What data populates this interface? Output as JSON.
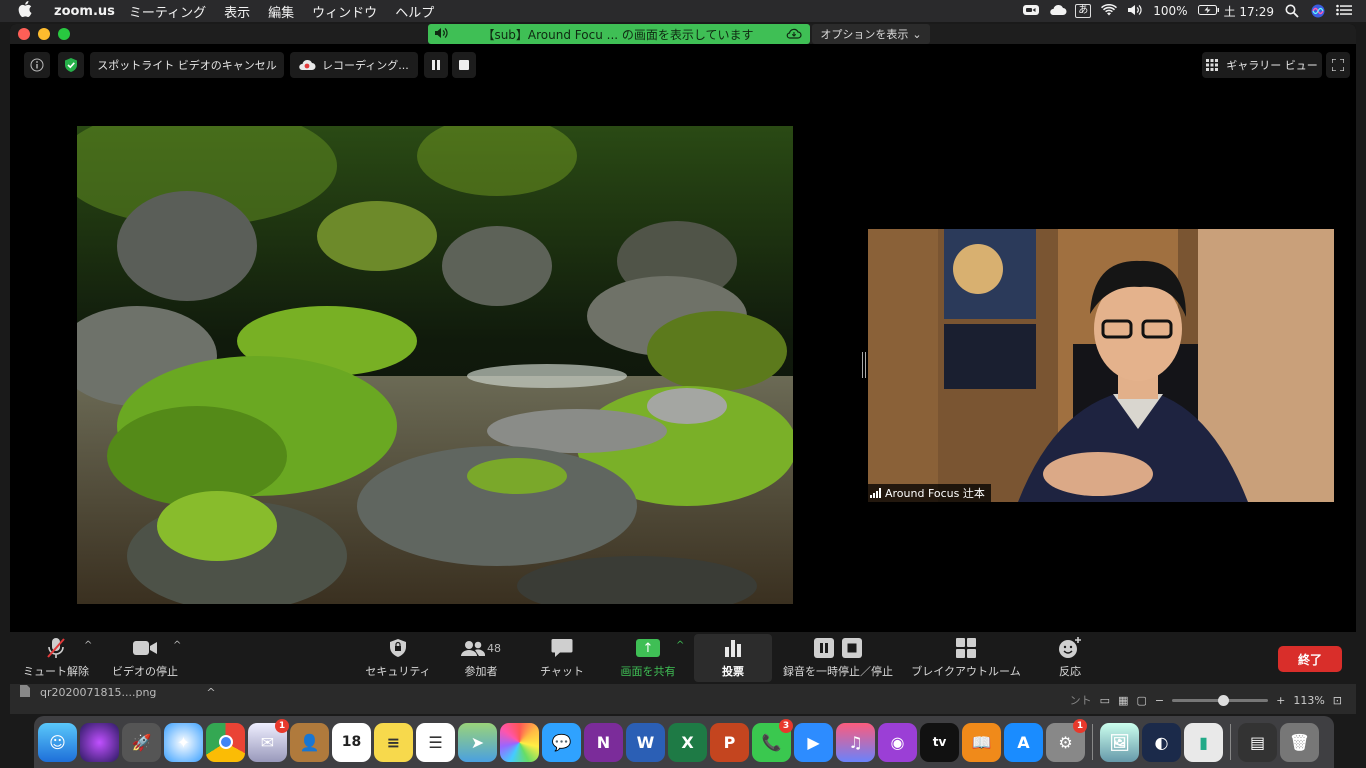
{
  "menubar": {
    "app_name": "zoom.us",
    "items": [
      "ミーティング",
      "表示",
      "編集",
      "ウィンドウ",
      "ヘルプ"
    ],
    "ime": "あ",
    "battery": "100%",
    "clock": "土 17:29"
  },
  "share_banner": {
    "text": "【sub】Around Focu ... の画面を表示しています",
    "options_label": "オプションを表示"
  },
  "topbar": {
    "spotlight_label": "スポットライト ビデオのキャンセル",
    "recording_label": "レコーディング...",
    "gallery_label": "ギャラリー ビュー"
  },
  "participant": {
    "name": "Around Focus 辻本"
  },
  "toolbar": {
    "mute_label": "ミュート解除",
    "video_label": "ビデオの停止",
    "security_label": "セキュリティ",
    "participants_label": "参加者",
    "participants_count": "48",
    "chat_label": "チャット",
    "share_label": "画面を共有",
    "poll_label": "投票",
    "rec_label": "録音を一時停止／停止",
    "breakout_label": "ブレイクアウトルーム",
    "reaction_label": "反応",
    "end_label": "終了"
  },
  "under_strip": {
    "file_name": "qr2020071815....png",
    "partial_text": "ント",
    "zoom_level": "113%"
  },
  "dock": {
    "calendar_day": "18",
    "badges": {
      "mail": "1",
      "facetime": "3",
      "settings": "1"
    },
    "appletv_label": "tv"
  },
  "colors": {
    "share_green": "#3fbf55",
    "end_red": "#d92e2a"
  }
}
